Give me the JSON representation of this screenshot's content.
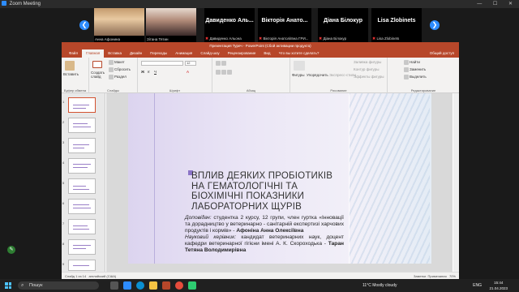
{
  "zoom": {
    "window_title": "Zoom Meeting",
    "win_controls": "— ☐ ✕",
    "participants": [
      {
        "name": "Анна Афонина",
        "video": true,
        "muted": false
      },
      {
        "name": "Зітана Тятин",
        "video": true,
        "muted": false
      },
      {
        "big_label": "Давиденко Аль...",
        "name": "Давиденко Альона",
        "video": false,
        "muted": true
      },
      {
        "big_label": "Вікторія Анато...",
        "name": "Вікторія Анатоліївна ГРИ...",
        "video": false,
        "muted": true
      },
      {
        "big_label": "Діана Білокур",
        "name": "Діана Білокур",
        "video": false,
        "muted": true
      },
      {
        "big_label": "Lisa Zlobinets",
        "name": "Lisa Zlobinets",
        "video": false,
        "muted": true
      }
    ],
    "prev_arrow": "❮",
    "next_arrow": "❯"
  },
  "ppt": {
    "title": "Презентация Туреч - PowerPoint (Сбой активации продукта)",
    "share_label": "Общий доступ",
    "tabs": [
      "Файл",
      "Главная",
      "Вставка",
      "Дизайн",
      "Переходы",
      "Анимация",
      "Слайд-шоу",
      "Рецензирование",
      "Вид",
      "Что вы хотите сделать?"
    ],
    "active_tab": "Главная",
    "ribbon": {
      "clipboard": {
        "name": "Буфер обмена",
        "paste": "Вставить"
      },
      "slides": {
        "name": "Слайды",
        "new_slide": "Создать слайд",
        "layout": "Макет",
        "reset": "Сбросить",
        "section": "Раздел"
      },
      "font": {
        "name": "Шрифт",
        "font_size": "12"
      },
      "paragraph": {
        "name": "Абзац"
      },
      "drawing": {
        "name": "Рисование",
        "shapes": "Фигуры",
        "arrange": "Упорядочить",
        "quick_styles": "Экспресс-стили",
        "fill": "Заливка фигуры",
        "outline": "Контур фигуры",
        "effects": "Эффекты фигуры"
      },
      "editing": {
        "name": "Редактирование",
        "find": "Найти",
        "replace": "Заменить",
        "select": "Выделить"
      }
    },
    "thumbnails": [
      "1",
      "2",
      "3",
      "4",
      "5",
      "6",
      "7",
      "8",
      "9"
    ],
    "active_thumb": 0,
    "slide": {
      "title": "ВПЛИВ ДЕЯКИХ ПРОБІОТИКІВ НА ГЕМАТОЛОГІЧНІ ТА БІОХІМІЧНІ ПОКАЗНИКИ ЛАБОРАТОРНИХ ЩУРІВ",
      "body_lead_italic": "Доповідач:",
      "body_lead": " студентка 2 курсу, 12 групи, член гуртка «Інновації та дорадництво у ветеринарно - санітарній експертизі харчових продуктів і кормів» - ",
      "body_lead_name": "Афоніна Анна Олексіївна",
      "body_sup_italic": "Науковий керівник:",
      "body_sup": " кандидат ветеринарних наук, доцент кафедри ветеринарної гігієни імені А. К. Скороходька - ",
      "body_sup_name": "Таран Тетяна Володимирівна"
    },
    "status": {
      "slide_of": "Слайд 1 из 14",
      "language": "английский (США)",
      "notes": "Заметки",
      "comments": "Примечания",
      "zoom": "70%"
    }
  },
  "taskbar": {
    "search_placeholder": "Пошук",
    "weather": "11°C  Mostly cloudy",
    "lang": "ENG",
    "time": "15:44",
    "date": "21.04.2023"
  },
  "colors": {
    "ppt_accent": "#b7472a",
    "zoom_blue": "#2d8cff",
    "slide_purple": "#8b74c7"
  }
}
